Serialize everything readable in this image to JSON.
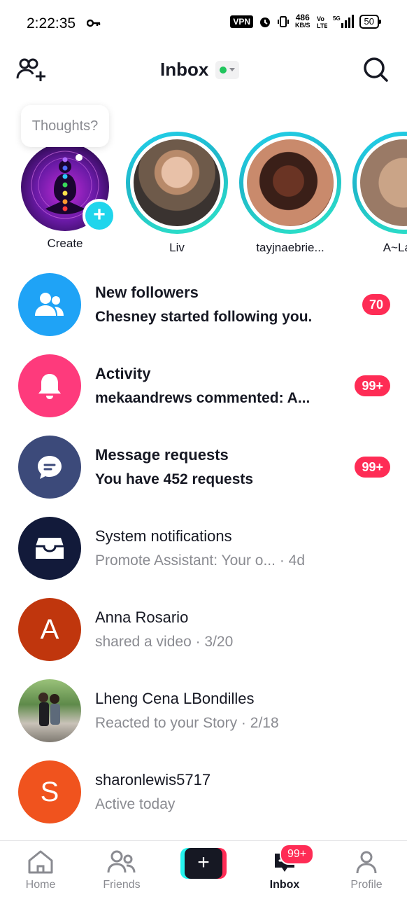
{
  "status_bar": {
    "time": "2:22:35",
    "vpn": "VPN",
    "net_speed": "486",
    "net_unit": "KB/S",
    "battery": "50"
  },
  "header": {
    "title": "Inbox",
    "online_status_color": "#21c55d"
  },
  "stories": {
    "thought_prompt": "Thoughts?",
    "create_label": "Create",
    "items": [
      {
        "name": "Liv"
      },
      {
        "name": "tayjnaebrie..."
      },
      {
        "name": "A~La'Al"
      }
    ]
  },
  "inbox": {
    "items": [
      {
        "title": "New followers",
        "subtitle": "Chesney started following you.",
        "badge": "70",
        "icon": "users-icon",
        "color": "#1fa3f6"
      },
      {
        "title": "Activity",
        "subtitle": "mekaandrews commented: A...",
        "badge": "99+",
        "icon": "bell-icon",
        "color": "#fe3a7c"
      },
      {
        "title": "Message requests",
        "subtitle": "You have 452 requests",
        "badge": "99+",
        "icon": "message-icon",
        "color": "#3c4a7a"
      },
      {
        "title": "System notifications",
        "subtitle": "Promote Assistant: Your o...  · 4d",
        "icon": "inbox-tray-icon",
        "color": "#121a3a"
      },
      {
        "title": "Anna Rosario",
        "subtitle": "shared a video · 3/20",
        "avatar_letter": "A",
        "color": "#c0360d"
      },
      {
        "title": "Lheng Cena LBondilles",
        "subtitle": "Reacted to your Story · 2/18"
      },
      {
        "title": "sharonlewis5717",
        "subtitle": "Active today",
        "avatar_letter": "S",
        "color": "#f0531e"
      }
    ]
  },
  "tabbar": {
    "home": "Home",
    "friends": "Friends",
    "inbox": "Inbox",
    "inbox_badge": "99+",
    "profile": "Profile"
  },
  "colors": {
    "accent": "#fe2c55",
    "cyan": "#25f4ee",
    "story_ring": "#22d3ee"
  }
}
